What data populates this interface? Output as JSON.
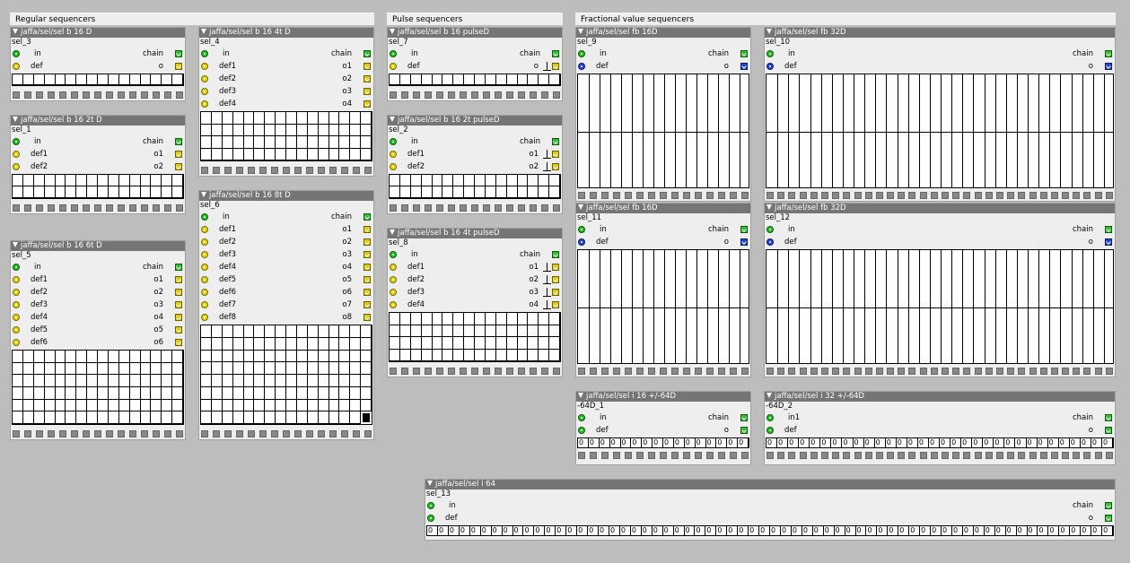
{
  "sections": {
    "regular": "Regular sequencers",
    "pulse": "Pulse sequencers",
    "fractional": "Fractional value sequencers"
  },
  "colors": {
    "background": "#bdbdbd",
    "panel": "#eeeeee",
    "titlebar": "#757575",
    "inlet": "#20c020",
    "def_inlet": "#e6d400",
    "frac_inlet": "#2244dd"
  },
  "labels": {
    "in": "in",
    "in1": "in1",
    "chain": "chain"
  },
  "patches": [
    {
      "title": "jaffa/sel/sel b 16 D",
      "name": "sel_3",
      "defs": [
        "def"
      ],
      "outs": [
        "o"
      ]
    },
    {
      "title": "jaffa/sel/sel b 16 2t D",
      "name": "sel_1",
      "defs": [
        "def1",
        "def2"
      ],
      "outs": [
        "o1",
        "o2"
      ]
    },
    {
      "title": "jaffa/sel/sel b 16 6t D",
      "name": "sel_5",
      "defs": [
        "def1",
        "def2",
        "def3",
        "def4",
        "def5",
        "def6"
      ],
      "outs": [
        "o1",
        "o2",
        "o3",
        "o4",
        "o5",
        "o6"
      ]
    },
    {
      "title": "jaffa/sel/sel b 16 4t D",
      "name": "sel_4",
      "defs": [
        "def1",
        "def2",
        "def3",
        "def4"
      ],
      "outs": [
        "o1",
        "o2",
        "o3",
        "o4"
      ]
    },
    {
      "title": "jaffa/sel/sel b 16 8t D",
      "name": "sel_6",
      "defs": [
        "def1",
        "def2",
        "def3",
        "def4",
        "def5",
        "def6",
        "def7",
        "def8"
      ],
      "outs": [
        "o1",
        "o2",
        "o3",
        "o4",
        "o5",
        "o6",
        "o7",
        "o8"
      ]
    },
    {
      "title": "jaffa/sel/sel b 16 pulseD",
      "name": "sel_7",
      "defs": [
        "def"
      ],
      "outs": [
        "o"
      ]
    },
    {
      "title": "jaffa/sel/sel b 16 2t pulseD",
      "name": "sel_2",
      "defs": [
        "def1",
        "def2"
      ],
      "outs": [
        "o1",
        "o2"
      ]
    },
    {
      "title": "jaffa/sel/sel b 16 4t pulseD",
      "name": "sel_8",
      "defs": [
        "def1",
        "def2",
        "def3",
        "def4"
      ],
      "outs": [
        "o1",
        "o2",
        "o3",
        "o4"
      ]
    },
    {
      "title": "jaffa/sel/sel fb 16D",
      "name": "sel_9",
      "defs": [
        "def"
      ],
      "outs": [
        "o"
      ]
    },
    {
      "title": "jaffa/sel/sel fb 32D",
      "name": "sel_10",
      "defs": [
        "def"
      ],
      "outs": [
        "o"
      ]
    },
    {
      "title": "jaffa/sel/sel fb 16D",
      "name": "sel_11",
      "defs": [
        "def"
      ],
      "outs": [
        "o"
      ]
    },
    {
      "title": "jaffa/sel/sel fb 32D",
      "name": "sel_12",
      "defs": [
        "def"
      ],
      "outs": [
        "o"
      ]
    },
    {
      "title": "jaffa/sel/sel i 16 +/-64D",
      "name": "-64D_1",
      "defs": [
        "def"
      ],
      "outs": [
        "o"
      ],
      "int_value": "0"
    },
    {
      "title": "jaffa/sel/sel i 32 +/-64D",
      "name": "-64D_2",
      "defs": [
        "def"
      ],
      "outs": [
        "o"
      ],
      "int_value": "0"
    },
    {
      "title": "jaffa/sel/sel i 64",
      "name": "sel_13",
      "defs": [
        "def"
      ],
      "outs": [
        "o"
      ],
      "int_value": "0"
    }
  ]
}
